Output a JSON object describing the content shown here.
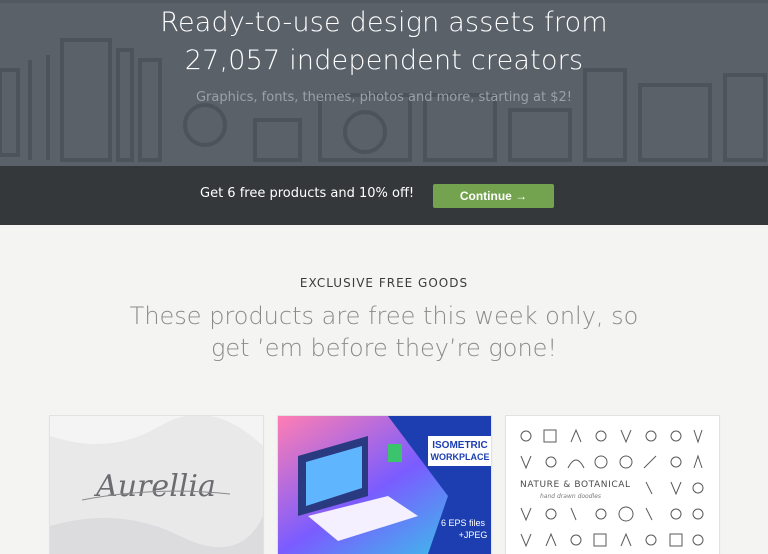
{
  "hero": {
    "title_line1": "Ready-to-use design assets from",
    "title_line2": "27,057 independent creators",
    "subtitle": "Graphics, fonts, themes, photos and more, starting at $2!"
  },
  "promo": {
    "text": "Get 6 free products and 10% off!",
    "button_label": "Continue →"
  },
  "section": {
    "label": "EXCLUSIVE FREE GOODS",
    "heading_line1": "These products are free this week only, so",
    "heading_line2": "get ’em before they’re gone!"
  },
  "products": [
    {
      "art_text": "Aurellia"
    },
    {
      "art_title_line1": "ISOMETRIC",
      "art_title_line2": "WORKPLACE",
      "art_badge_line1": "6 EPS files",
      "art_badge_line2": "+JPEG"
    },
    {
      "art_title": "NATURE & BOTANICAL",
      "art_subtitle": "hand drawn doodles"
    }
  ],
  "colors": {
    "hero_bg": "#5a6169",
    "promo_bg": "#34383b",
    "button": "#73a34e",
    "page_bg": "#f4f4f2"
  }
}
